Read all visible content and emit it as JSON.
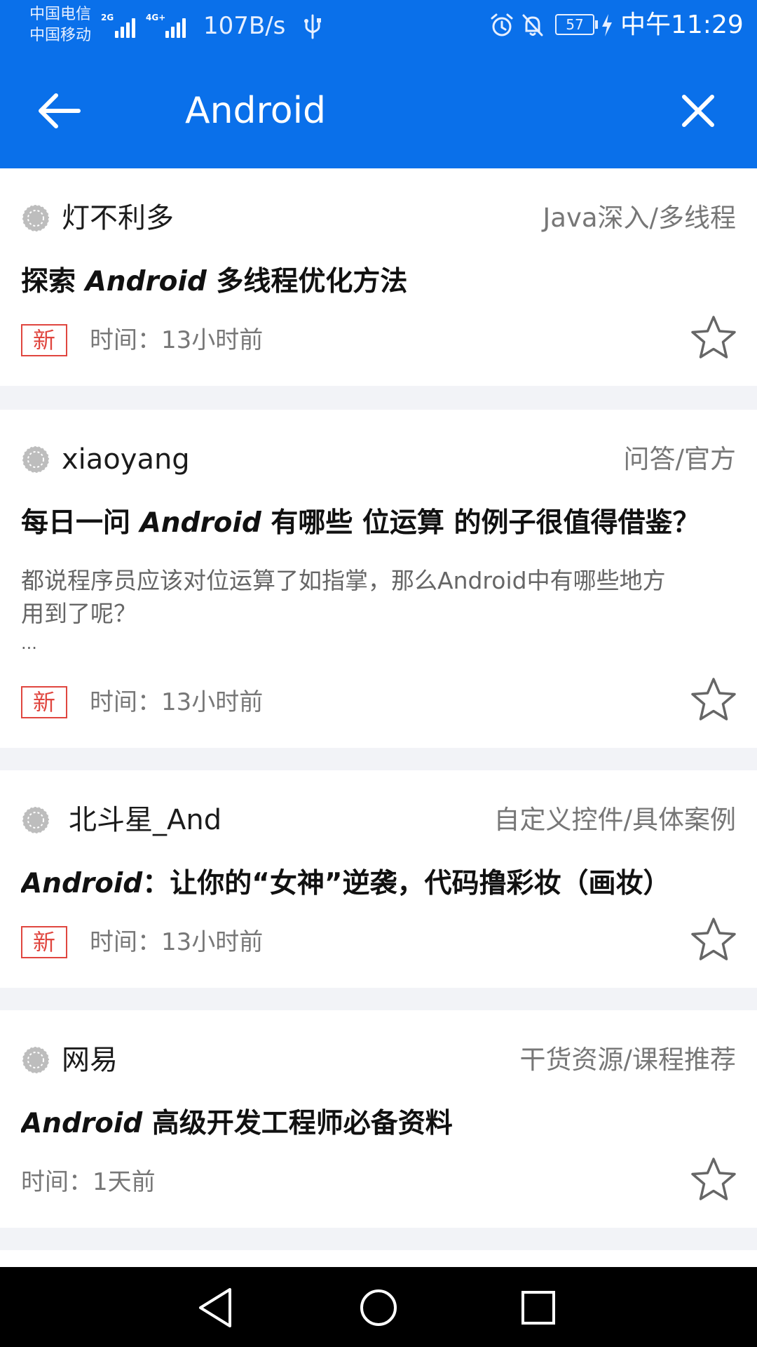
{
  "status_bar": {
    "carrier_1": "中国电信",
    "carrier_2": "中国移动",
    "signal_1_tag": "2G",
    "signal_2_tag": "4G+",
    "net_speed": "107B/s",
    "battery_level": "57",
    "time": "中午11:29"
  },
  "search": {
    "query": "Android"
  },
  "feed": {
    "new_badge_label": "新",
    "items": [
      {
        "author": "灯不利多",
        "category": "Java深入/多线程",
        "title_prefix": "探索 ",
        "title_keyword": "Android",
        "title_suffix": " 多线程优化方法",
        "time": "时间：13小时前",
        "is_new": true
      },
      {
        "author": "xiaoyang",
        "category": "问答/官方",
        "title_prefix": "每日一问 ",
        "title_keyword": "Android",
        "title_suffix": " 有哪些 位运算 的例子很值得借鉴？",
        "summary_line_1": "都说程序员应该对位运算了如指掌，那么Android中有哪些地方",
        "summary_line_2": "用到了呢？",
        "summary_line_3": "...",
        "time": "时间：13小时前",
        "is_new": true
      },
      {
        "author": "北斗星_And",
        "category": "自定义控件/具体案例",
        "title_prefix": "",
        "title_keyword": "Android",
        "title_suffix": "：让你的“女神”逆袭，代码撸彩妆（画妆）",
        "time": "时间：13小时前",
        "is_new": true
      },
      {
        "author": "网易",
        "category": "干货资源/课程推荐",
        "title_prefix": "",
        "title_keyword": "Android",
        "title_suffix": " 高级开发工程师必备资料",
        "time": "时间：1天前",
        "is_new": false
      }
    ]
  },
  "colors": {
    "primary": "#0a70ea",
    "new_badge": "#e0463f",
    "card_bg": "#ffffff",
    "page_bg": "#f2f3f7"
  }
}
